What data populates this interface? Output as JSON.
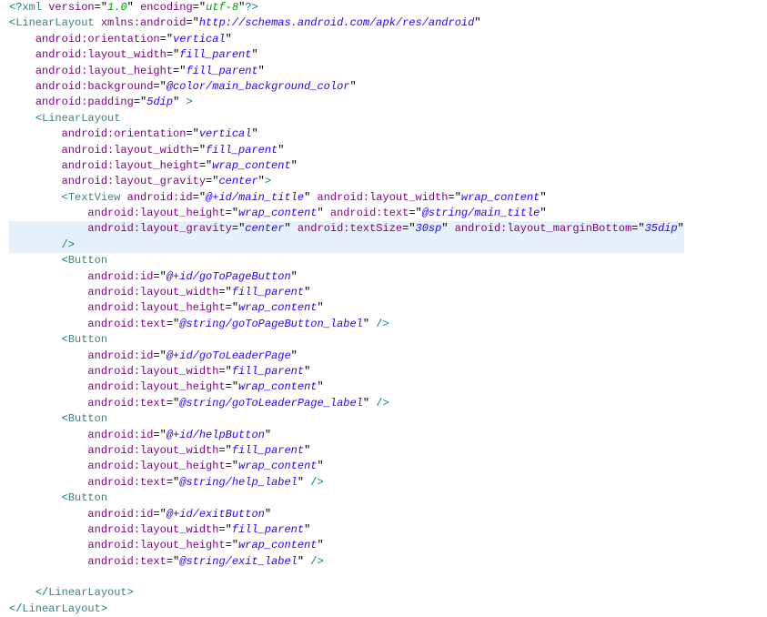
{
  "lines": [
    {
      "indent": 0,
      "tokens": [
        [
          "bracket",
          "<?"
        ],
        [
          "tagname",
          "xml"
        ],
        [
          " ",
          " "
        ],
        [
          "attrname",
          "version"
        ],
        [
          "eq",
          "="
        ],
        [
          "quote",
          "\""
        ],
        [
          "strval",
          "1.0"
        ],
        [
          "quote",
          "\""
        ],
        [
          " ",
          " "
        ],
        [
          "attrname",
          "encoding"
        ],
        [
          "eq",
          "="
        ],
        [
          "quote",
          "\""
        ],
        [
          "strval",
          "utf-8"
        ],
        [
          "quote",
          "\""
        ],
        [
          "bracket",
          "?>"
        ]
      ],
      "cls": "xmldecl"
    },
    {
      "indent": 0,
      "tokens": [
        [
          "bracket",
          "<"
        ],
        [
          "tagname",
          "LinearLayout"
        ],
        [
          " ",
          " "
        ],
        [
          "attrname",
          "xmlns:android"
        ],
        [
          "eq",
          "="
        ],
        [
          "quote",
          "\""
        ],
        [
          "strval",
          "http://schemas.android.com/apk/res/android"
        ],
        [
          "quote",
          "\""
        ]
      ]
    },
    {
      "indent": 4,
      "tokens": [
        [
          "attrname",
          "android:orientation"
        ],
        [
          "eq",
          "="
        ],
        [
          "quote",
          "\""
        ],
        [
          "strval",
          "vertical"
        ],
        [
          "quote",
          "\""
        ]
      ]
    },
    {
      "indent": 4,
      "tokens": [
        [
          "attrname",
          "android:layout_width"
        ],
        [
          "eq",
          "="
        ],
        [
          "quote",
          "\""
        ],
        [
          "strval",
          "fill_parent"
        ],
        [
          "quote",
          "\""
        ]
      ]
    },
    {
      "indent": 4,
      "tokens": [
        [
          "attrname",
          "android:layout_height"
        ],
        [
          "eq",
          "="
        ],
        [
          "quote",
          "\""
        ],
        [
          "strval",
          "fill_parent"
        ],
        [
          "quote",
          "\""
        ]
      ]
    },
    {
      "indent": 4,
      "tokens": [
        [
          "attrname",
          "android:background"
        ],
        [
          "eq",
          "="
        ],
        [
          "quote",
          "\""
        ],
        [
          "strval",
          "@color/main_background_color"
        ],
        [
          "quote",
          "\""
        ]
      ]
    },
    {
      "indent": 4,
      "tokens": [
        [
          "attrname",
          "android:padding"
        ],
        [
          "eq",
          "="
        ],
        [
          "quote",
          "\""
        ],
        [
          "strval",
          "5dip"
        ],
        [
          "quote",
          "\""
        ],
        [
          " ",
          " "
        ],
        [
          "gt",
          ">"
        ]
      ]
    },
    {
      "indent": 4,
      "tokens": [
        [
          "bracket",
          "<"
        ],
        [
          "tagname",
          "LinearLayout"
        ]
      ]
    },
    {
      "indent": 8,
      "tokens": [
        [
          "attrname",
          "android:orientation"
        ],
        [
          "eq",
          "="
        ],
        [
          "quote",
          "\""
        ],
        [
          "strval",
          "vertical"
        ],
        [
          "quote",
          "\""
        ]
      ]
    },
    {
      "indent": 8,
      "tokens": [
        [
          "attrname",
          "android:layout_width"
        ],
        [
          "eq",
          "="
        ],
        [
          "quote",
          "\""
        ],
        [
          "strval",
          "fill_parent"
        ],
        [
          "quote",
          "\""
        ]
      ]
    },
    {
      "indent": 8,
      "tokens": [
        [
          "attrname",
          "android:layout_height"
        ],
        [
          "eq",
          "="
        ],
        [
          "quote",
          "\""
        ],
        [
          "strval",
          "wrap_content"
        ],
        [
          "quote",
          "\""
        ]
      ]
    },
    {
      "indent": 8,
      "tokens": [
        [
          "attrname",
          "android:layout_gravity"
        ],
        [
          "eq",
          "="
        ],
        [
          "quote",
          "\""
        ],
        [
          "strval",
          "center"
        ],
        [
          "quote",
          "\""
        ],
        [
          "gt",
          ">"
        ]
      ]
    },
    {
      "indent": 8,
      "hl": false,
      "hlpartial": true,
      "tokens": [
        [
          "bracket",
          "<"
        ],
        [
          "tagname",
          "TextView"
        ],
        [
          " ",
          " "
        ],
        [
          "attrname",
          "android:id"
        ],
        [
          "eq",
          "="
        ],
        [
          "quote",
          "\""
        ],
        [
          "strval",
          "@+id/main_title"
        ],
        [
          "quote",
          "\""
        ],
        [
          " ",
          " "
        ],
        [
          "attrname",
          "android:layout_width"
        ],
        [
          "eq",
          "="
        ],
        [
          "quote",
          "\""
        ],
        [
          "strval",
          "wrap_content"
        ],
        [
          "quote",
          "\""
        ]
      ]
    },
    {
      "indent": 12,
      "tokens": [
        [
          "attrname",
          "android:layout_height"
        ],
        [
          "eq",
          "="
        ],
        [
          "quote",
          "\""
        ],
        [
          "strval",
          "wrap_content"
        ],
        [
          "quote",
          "\""
        ],
        [
          " ",
          " "
        ],
        [
          "attrname",
          "android:text"
        ],
        [
          "eq",
          "="
        ],
        [
          "quote",
          "\""
        ],
        [
          "strval",
          "@string/main_title"
        ],
        [
          "quote",
          "\""
        ]
      ]
    },
    {
      "indent": 12,
      "hl": true,
      "tokens": [
        [
          "attrname",
          "android:layout_gravity"
        ],
        [
          "eq",
          "="
        ],
        [
          "quote",
          "\""
        ],
        [
          "strval",
          "center"
        ],
        [
          "quote",
          "\""
        ],
        [
          " ",
          " "
        ],
        [
          "attrname",
          "android:textSize"
        ],
        [
          "eq",
          "="
        ],
        [
          "quote",
          "\""
        ],
        [
          "strval",
          "30sp"
        ],
        [
          "quote",
          "\""
        ],
        [
          " ",
          " "
        ],
        [
          "attrname",
          "android:layout_marginBottom"
        ],
        [
          "eq",
          "="
        ],
        [
          "quote",
          "\""
        ],
        [
          "strval",
          "35dip"
        ],
        [
          "quote",
          "\""
        ]
      ]
    },
    {
      "indent": 8,
      "hl": true,
      "tokens": [
        [
          "bracket",
          "/>"
        ]
      ]
    },
    {
      "indent": 8,
      "tokens": [
        [
          "bracket",
          "<"
        ],
        [
          "tagname",
          "Button"
        ]
      ]
    },
    {
      "indent": 12,
      "tokens": [
        [
          "attrname",
          "android:id"
        ],
        [
          "eq",
          "="
        ],
        [
          "quote",
          "\""
        ],
        [
          "strval",
          "@+id/goToPageButton"
        ],
        [
          "quote",
          "\""
        ]
      ]
    },
    {
      "indent": 12,
      "tokens": [
        [
          "attrname",
          "android:layout_width"
        ],
        [
          "eq",
          "="
        ],
        [
          "quote",
          "\""
        ],
        [
          "strval",
          "fill_parent"
        ],
        [
          "quote",
          "\""
        ]
      ]
    },
    {
      "indent": 12,
      "tokens": [
        [
          "attrname",
          "android:layout_height"
        ],
        [
          "eq",
          "="
        ],
        [
          "quote",
          "\""
        ],
        [
          "strval",
          "wrap_content"
        ],
        [
          "quote",
          "\""
        ]
      ]
    },
    {
      "indent": 12,
      "tokens": [
        [
          "attrname",
          "android:text"
        ],
        [
          "eq",
          "="
        ],
        [
          "quote",
          "\""
        ],
        [
          "strval",
          "@string/goToPageButton_label"
        ],
        [
          "quote",
          "\""
        ],
        [
          " ",
          " "
        ],
        [
          "bracket",
          "/>"
        ]
      ]
    },
    {
      "indent": 8,
      "tokens": [
        [
          "bracket",
          "<"
        ],
        [
          "tagname",
          "Button"
        ]
      ]
    },
    {
      "indent": 12,
      "tokens": [
        [
          "attrname",
          "android:id"
        ],
        [
          "eq",
          "="
        ],
        [
          "quote",
          "\""
        ],
        [
          "strval",
          "@+id/goToLeaderPage"
        ],
        [
          "quote",
          "\""
        ]
      ]
    },
    {
      "indent": 12,
      "tokens": [
        [
          "attrname",
          "android:layout_width"
        ],
        [
          "eq",
          "="
        ],
        [
          "quote",
          "\""
        ],
        [
          "strval",
          "fill_parent"
        ],
        [
          "quote",
          "\""
        ]
      ]
    },
    {
      "indent": 12,
      "tokens": [
        [
          "attrname",
          "android:layout_height"
        ],
        [
          "eq",
          "="
        ],
        [
          "quote",
          "\""
        ],
        [
          "strval",
          "wrap_content"
        ],
        [
          "quote",
          "\""
        ]
      ]
    },
    {
      "indent": 12,
      "tokens": [
        [
          "attrname",
          "android:text"
        ],
        [
          "eq",
          "="
        ],
        [
          "quote",
          "\""
        ],
        [
          "strval",
          "@string/goToLeaderPage_label"
        ],
        [
          "quote",
          "\""
        ],
        [
          " ",
          " "
        ],
        [
          "bracket",
          "/>"
        ]
      ]
    },
    {
      "indent": 8,
      "tokens": [
        [
          "bracket",
          "<"
        ],
        [
          "tagname",
          "Button"
        ]
      ]
    },
    {
      "indent": 12,
      "tokens": [
        [
          "attrname",
          "android:id"
        ],
        [
          "eq",
          "="
        ],
        [
          "quote",
          "\""
        ],
        [
          "strval",
          "@+id/helpButton"
        ],
        [
          "quote",
          "\""
        ]
      ]
    },
    {
      "indent": 12,
      "tokens": [
        [
          "attrname",
          "android:layout_width"
        ],
        [
          "eq",
          "="
        ],
        [
          "quote",
          "\""
        ],
        [
          "strval",
          "fill_parent"
        ],
        [
          "quote",
          "\""
        ]
      ]
    },
    {
      "indent": 12,
      "tokens": [
        [
          "attrname",
          "android:layout_height"
        ],
        [
          "eq",
          "="
        ],
        [
          "quote",
          "\""
        ],
        [
          "strval",
          "wrap_content"
        ],
        [
          "quote",
          "\""
        ]
      ]
    },
    {
      "indent": 12,
      "tokens": [
        [
          "attrname",
          "android:text"
        ],
        [
          "eq",
          "="
        ],
        [
          "quote",
          "\""
        ],
        [
          "strval",
          "@string/help_label"
        ],
        [
          "quote",
          "\""
        ],
        [
          " ",
          " "
        ],
        [
          "bracket",
          "/>"
        ]
      ]
    },
    {
      "indent": 8,
      "tokens": [
        [
          "bracket",
          "<"
        ],
        [
          "tagname",
          "Button"
        ]
      ]
    },
    {
      "indent": 12,
      "tokens": [
        [
          "attrname",
          "android:id"
        ],
        [
          "eq",
          "="
        ],
        [
          "quote",
          "\""
        ],
        [
          "strval",
          "@+id/exitButton"
        ],
        [
          "quote",
          "\""
        ]
      ]
    },
    {
      "indent": 12,
      "tokens": [
        [
          "attrname",
          "android:layout_width"
        ],
        [
          "eq",
          "="
        ],
        [
          "quote",
          "\""
        ],
        [
          "strval",
          "fill_parent"
        ],
        [
          "quote",
          "\""
        ]
      ]
    },
    {
      "indent": 12,
      "tokens": [
        [
          "attrname",
          "android:layout_height"
        ],
        [
          "eq",
          "="
        ],
        [
          "quote",
          "\""
        ],
        [
          "strval",
          "wrap_content"
        ],
        [
          "quote",
          "\""
        ]
      ]
    },
    {
      "indent": 12,
      "tokens": [
        [
          "attrname",
          "android:text"
        ],
        [
          "eq",
          "="
        ],
        [
          "quote",
          "\""
        ],
        [
          "strval",
          "@string/exit_label"
        ],
        [
          "quote",
          "\""
        ],
        [
          " ",
          " "
        ],
        [
          "bracket",
          "/>"
        ]
      ]
    },
    {
      "indent": 0,
      "tokens": [
        [
          " ",
          ""
        ]
      ]
    },
    {
      "indent": 4,
      "tokens": [
        [
          "bracket",
          "</"
        ],
        [
          "tagname",
          "LinearLayout"
        ],
        [
          "bracket",
          ">"
        ]
      ]
    },
    {
      "indent": 0,
      "tokens": [
        [
          "bracket",
          "</"
        ],
        [
          "tagname",
          "LinearLayout"
        ],
        [
          "bracket",
          ">"
        ]
      ]
    }
  ]
}
